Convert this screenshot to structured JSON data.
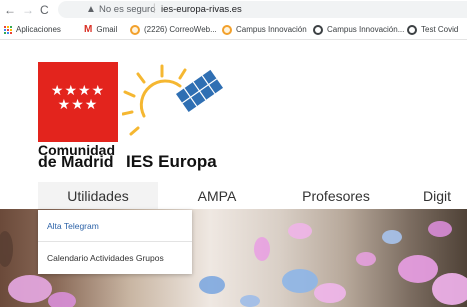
{
  "browser": {
    "back_icon": "arrow-left-icon",
    "forward_icon": "arrow-right-icon",
    "reload_icon": "reload-icon",
    "security_icon": "warning-triangle-icon",
    "security_label": "No es seguro",
    "separator": "|",
    "url": "ies-europa-rivas.es"
  },
  "bookmarks": [
    {
      "label": "Aplicaciones",
      "icon": "apps-grid-icon"
    },
    {
      "label": "Gmail",
      "icon": "gmail-icon"
    },
    {
      "label": "(2226) CorreoWeb...",
      "icon": "webmail-icon"
    },
    {
      "label": "Campus Innovación",
      "icon": "webmail-icon"
    },
    {
      "label": "Campus Innovación...",
      "icon": "globe-icon"
    },
    {
      "label": "Test Covid",
      "icon": "globe-icon"
    }
  ],
  "logo": {
    "stars": "★★★★\n★★★",
    "line1": "Comunidad",
    "line2": "de Madrid",
    "school": "IES Europa",
    "red": "#e3241d",
    "sun": "#f5b731",
    "panel": "#2f6fb3"
  },
  "nav": {
    "items": [
      {
        "label": "Utilidades"
      },
      {
        "label": "AMPA"
      },
      {
        "label": "Profesores"
      },
      {
        "label": "Digit"
      }
    ]
  },
  "dropdown": {
    "items": [
      {
        "label": "Alta Telegram"
      },
      {
        "label": "Calendario Actividades Grupos"
      }
    ]
  },
  "colors": {
    "link": "#2d63a8",
    "nav_active_bg": "#f3f3f3"
  }
}
